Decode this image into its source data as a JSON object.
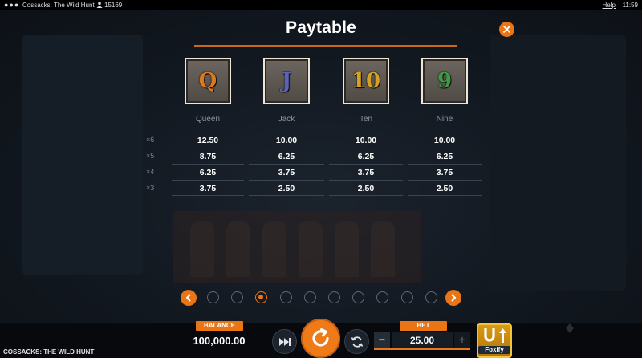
{
  "topbar": {
    "menu_dots": "●●●",
    "game_title": "Cossacks: The Wild Hunt",
    "player_count": "15169",
    "help_label": "Help",
    "clock": "11:59"
  },
  "paytable": {
    "title": "Paytable",
    "symbols": [
      {
        "glyph": "Q",
        "name": "Queen",
        "color": "#d97a1e"
      },
      {
        "glyph": "J",
        "name": "Jack",
        "color": "#5b63b8"
      },
      {
        "glyph": "10",
        "name": "Ten",
        "color": "#d6a020"
      },
      {
        "glyph": "9",
        "name": "Nine",
        "color": "#3f9a43"
      }
    ],
    "multipliers": [
      "×6",
      "×5",
      "×4",
      "×3"
    ],
    "payouts": [
      [
        "12.50",
        "10.00",
        "10.00",
        "10.00"
      ],
      [
        "8.75",
        "6.25",
        "6.25",
        "6.25"
      ],
      [
        "6.25",
        "3.75",
        "3.75",
        "3.75"
      ],
      [
        "3.75",
        "2.50",
        "2.50",
        "2.50"
      ]
    ],
    "pages_total": 10,
    "active_page": 3
  },
  "bottom": {
    "game_name": "COSSACKS: THE WILD HUNT",
    "balance_label": "BALANCE",
    "balance_value": "100,000.00",
    "bet_label": "BET",
    "bet_value": "25.00",
    "bet_minus": "−",
    "bet_plus": "+",
    "foxify_label": "Foxify"
  },
  "colors": {
    "accent": "#ea7517",
    "background": "#0c0e13"
  }
}
